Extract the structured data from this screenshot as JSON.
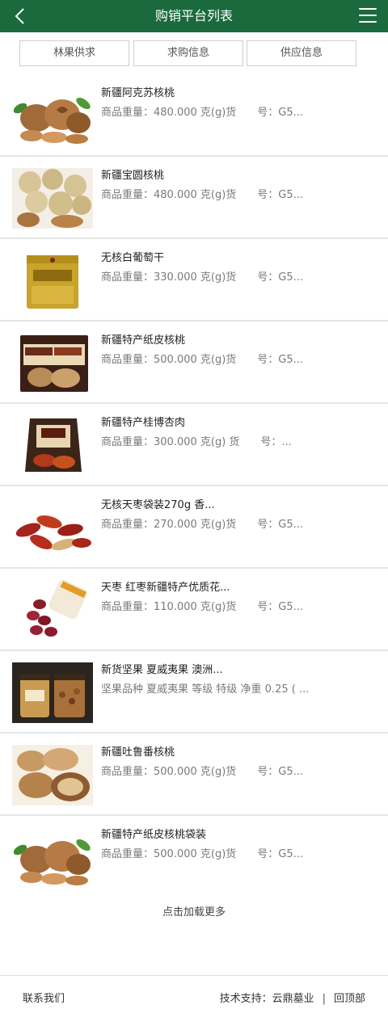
{
  "header": {
    "title": "购销平台列表",
    "back_icon": "back-chevron-icon",
    "menu_icon": "hamburger-menu-icon",
    "bg_color": "#1a6a3d"
  },
  "tabs": [
    {
      "label": "林果供求"
    },
    {
      "label": "求购信息"
    },
    {
      "label": "供应信息"
    }
  ],
  "items": [
    {
      "name": "新疆阿克苏核桃",
      "meta": "商品重量：480.000 克(g)货　　号：G5...",
      "image": "walnut-with-leaves"
    },
    {
      "name": "新疆宝圆核桃",
      "meta": "商品重量：480.000 克(g)货　　号：G5...",
      "image": "round-walnuts"
    },
    {
      "name": "无核白葡萄干",
      "meta": "商品重量：330.000 克(g)货　　号：G5...",
      "image": "raisin-bag"
    },
    {
      "name": "新疆特产纸皮核桃",
      "meta": "商品重量：500.000 克(g)货　　号：G5...",
      "image": "paper-walnut-bag"
    },
    {
      "name": "新疆特产桂博杏肉",
      "meta": "商品重量：300.000 克(g) 货　　号：...",
      "image": "apricot-bag"
    },
    {
      "name": "无核天枣袋装270g 香...",
      "meta": "商品重量：270.000 克(g)货　　号：G5...",
      "image": "red-dates"
    },
    {
      "name": "天枣 红枣新疆特产优质花...",
      "meta": "商品重量：110.000 克(g)货　　号：G5...",
      "image": "dates-jar"
    },
    {
      "name": "新货坚果 夏威夷果 澳洲...",
      "meta": "坚果品种 夏威夷果 等级 特级 净重 0.25 ( ...",
      "image": "nut-jars"
    },
    {
      "name": "新疆吐鲁番核桃",
      "meta": "商品重量：500.000 克(g)货　　号：G5...",
      "image": "walnut-kernels"
    },
    {
      "name": "新疆特产纸皮核桃袋装",
      "meta": "商品重量：500.000 克(g)货　　号：G5...",
      "image": "walnut-with-leaves"
    }
  ],
  "load_more": "点击加载更多",
  "footer": {
    "contact": "联系我们",
    "support": "技术支持：云鼎墓业",
    "separator": "|",
    "back_to_top": "回顶部"
  }
}
